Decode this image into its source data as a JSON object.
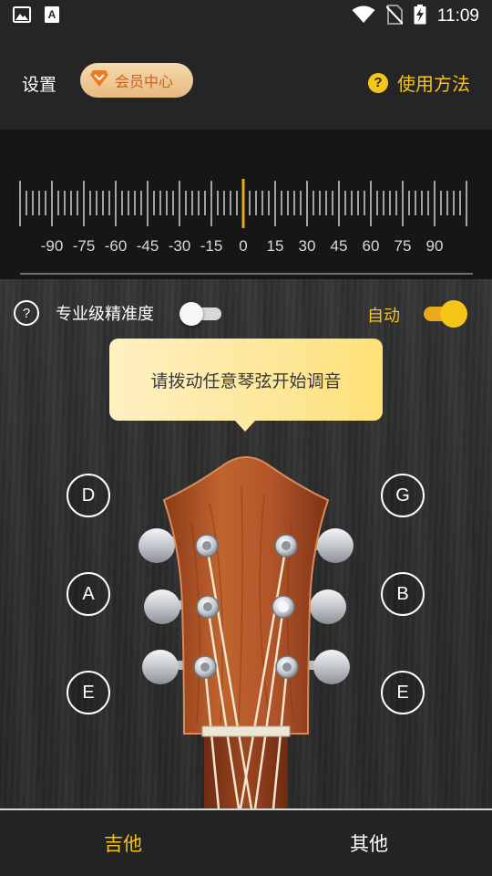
{
  "status_bar": {
    "time": "11:09",
    "icons": [
      "image-icon",
      "font-a-icon",
      "wifi-icon",
      "no-sim-icon",
      "battery-charging-icon"
    ]
  },
  "header": {
    "settings_label": "设置",
    "vip_label": "会员中心",
    "help_label": "使用方法",
    "help_icon": "?"
  },
  "meter": {
    "scale_labels": [
      "-90",
      "-75",
      "-60",
      "-45",
      "-30",
      "-15",
      "0",
      "15",
      "30",
      "45",
      "60",
      "75",
      "90"
    ],
    "needle_value": 0,
    "needle_color": "#e8a91a"
  },
  "controls": {
    "pro_icon": "?",
    "pro_label": "专业级精准度",
    "pro_enabled": false,
    "auto_label": "自动",
    "auto_enabled": true
  },
  "tooltip": {
    "text": "请拨动任意琴弦开始调音"
  },
  "strings": {
    "left": [
      "D",
      "A",
      "E"
    ],
    "right": [
      "G",
      "B",
      "E"
    ]
  },
  "tabs": {
    "guitar": "吉他",
    "other": "其他",
    "active": "guitar"
  },
  "colors": {
    "accent": "#f5c518",
    "vip_text": "#c7631f",
    "headstock": "#b35a2a"
  }
}
